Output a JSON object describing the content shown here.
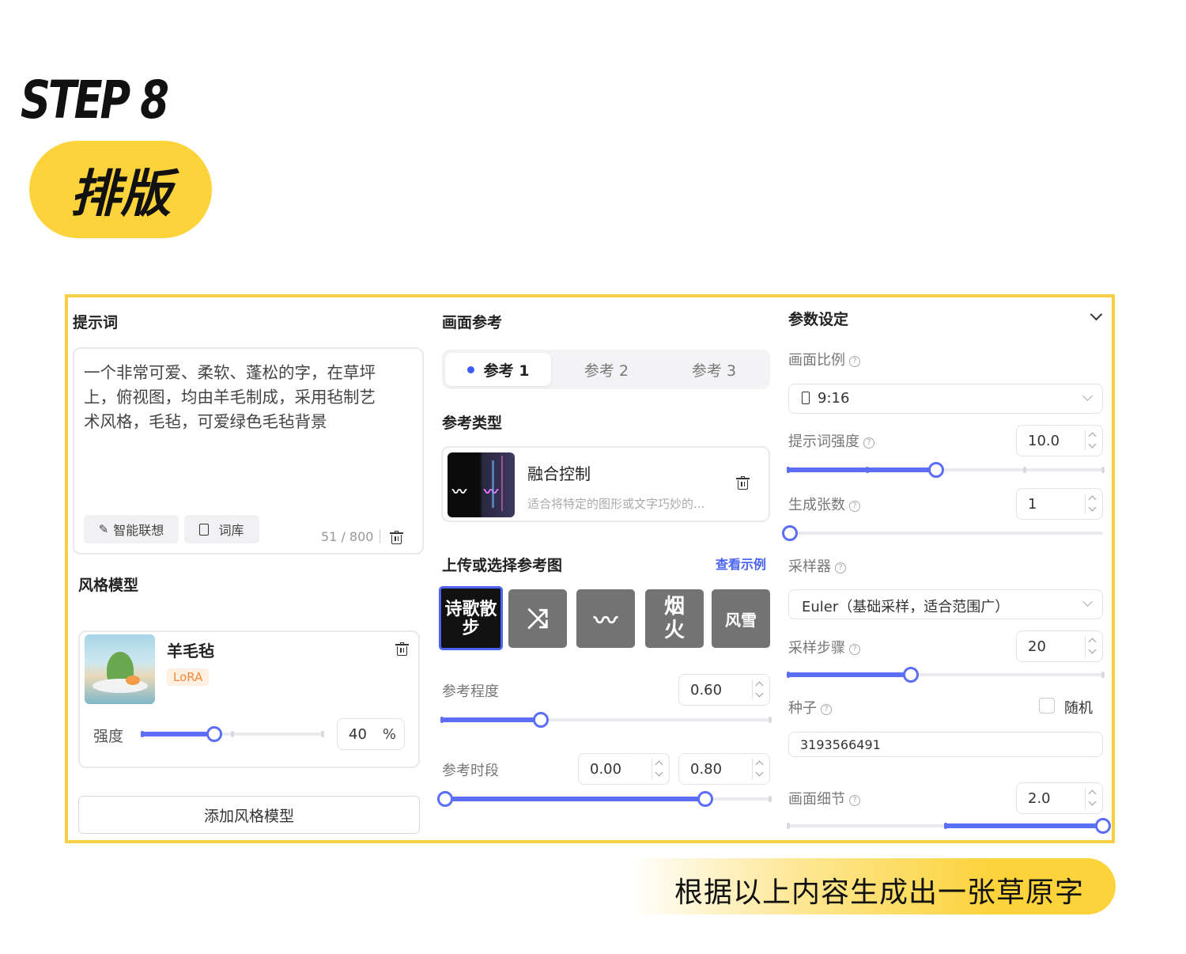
{
  "header": {
    "step": "STEP 8",
    "step_title": "排版"
  },
  "prompt_panel": {
    "title": "提示词",
    "text": "一个非常可爱、柔软、蓬松的字，在草坪上，俯视图，均由羊毛制成，采用毡制艺术风格，毛毡，可爱绿色毛毡背景",
    "smart_assoc_label": "智能联想",
    "lexicon_label": "词库",
    "counter": "51 / 800"
  },
  "style_model": {
    "title": "风格模型",
    "name": "羊毛毡",
    "tag": "LoRA",
    "strength_label": "强度",
    "strength_value": "40",
    "strength_unit": "%",
    "strength_fraction": 0.4,
    "add_button": "添加风格模型"
  },
  "reference": {
    "title": "画面参考",
    "tabs": [
      "参考 1",
      "参考 2",
      "参考 3"
    ],
    "active_tab": 0,
    "type_title": "参考类型",
    "type_name": "融合控制",
    "type_desc": "适合将特定的图形或文字巧妙的...",
    "upload_title": "上传或选择参考图",
    "view_examples": "查看示例",
    "images": [
      "诗歌散步",
      "",
      "",
      "烟火",
      "风雪"
    ],
    "degree_label": "参考程度",
    "degree_value": "0.60",
    "degree_fraction": 0.3,
    "period_label": "参考时段",
    "period_start": "0.00",
    "period_end": "0.80",
    "period_fraction_start": 0,
    "period_fraction_end": 0.8
  },
  "params": {
    "title": "参数设定",
    "aspect_label": "画面比例",
    "aspect_value": "9:16",
    "prompt_strength_label": "提示词强度",
    "prompt_strength_value": "10.0",
    "prompt_strength_fraction": 0.47,
    "count_label": "生成张数",
    "count_value": "1",
    "count_fraction": 0,
    "sampler_label": "采样器",
    "sampler_value": "Euler（基础采样，适合范围广）",
    "steps_label": "采样步骤",
    "steps_value": "20",
    "steps_fraction": 0.39,
    "seed_label": "种子",
    "random_label": "随机",
    "seed_value": "3193566491",
    "detail_label": "画面细节",
    "detail_value": "2.0",
    "detail_fraction_start": 0.5,
    "detail_fraction_end": 1
  },
  "footer": {
    "caption": "根据以上内容生成出一张草原字"
  },
  "colors": {
    "accent": "#5b6ef5",
    "brand_yellow": "#fcd33b",
    "lora_tag": "#f08a3e"
  }
}
